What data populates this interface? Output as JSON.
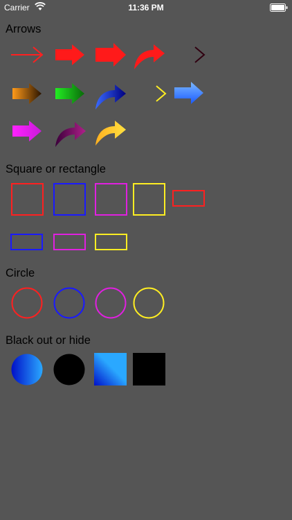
{
  "status_bar": {
    "carrier": "Carrier",
    "time": "11:36 PM"
  },
  "sections": {
    "arrows": "Arrows",
    "shapes": "Square or rectangle",
    "circle": "Circle",
    "blackout": "Black out or hide"
  },
  "colors": {
    "background": "#555555",
    "red": "#ff2020",
    "blue": "#1a1aff",
    "magenta": "#e020e0",
    "yellow": "#ffee22",
    "black": "#000000"
  },
  "tools": {
    "arrows": [
      "thin-red-arrow",
      "red-block-arrow",
      "red-large-block-arrow",
      "red-curved-arrow",
      "dark-red-gradient-thin-arrow",
      "orange-gradient-block-arrow",
      "green-gradient-block-arrow",
      "blue-gradient-curved-arrow",
      "yellow-gradient-thin-arrow",
      "light-blue-block-arrow",
      "magenta-block-arrow",
      "purple-curved-arrow",
      "yellow-curved-arrow"
    ],
    "rectangles": [
      "red-square",
      "blue-square",
      "magenta-square",
      "yellow-square",
      "red-rectangle",
      "blue-rectangle",
      "magenta-rectangle",
      "yellow-rectangle"
    ],
    "circles": [
      "red-circle",
      "blue-circle",
      "magenta-circle",
      "yellow-circle"
    ],
    "blackout": [
      "blue-gradient-circle",
      "black-circle",
      "blue-gradient-square",
      "black-square"
    ]
  }
}
